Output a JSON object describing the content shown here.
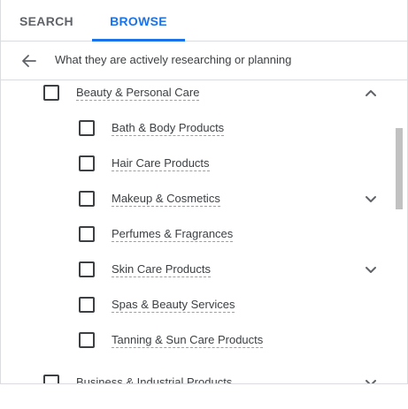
{
  "tabs": [
    {
      "label": "SEARCH",
      "active": false
    },
    {
      "label": "BROWSE",
      "active": true
    }
  ],
  "accent_color": "#1a73e8",
  "back_row": {
    "text": "What they are actively researching or planning",
    "icon": "arrow-left-icon"
  },
  "categories": {
    "parent": {
      "label": "Beauty & Personal Care",
      "checked": false,
      "expanded": true,
      "icon": "chevron-up-icon"
    },
    "children": [
      {
        "label": "Bath & Body Products",
        "checked": false,
        "has_children": false
      },
      {
        "label": "Hair Care Products",
        "checked": false,
        "has_children": false
      },
      {
        "label": "Makeup & Cosmetics",
        "checked": false,
        "has_children": true
      },
      {
        "label": "Perfumes & Fragrances",
        "checked": false,
        "has_children": false
      },
      {
        "label": "Skin Care Products",
        "checked": false,
        "has_children": true
      },
      {
        "label": "Spas & Beauty Services",
        "checked": false,
        "has_children": false
      },
      {
        "label": "Tanning & Sun Care Products",
        "checked": false,
        "has_children": false
      }
    ],
    "next_parent": {
      "label": "Business & Industrial Products",
      "checked": false,
      "expanded": false,
      "icon": "chevron-down-icon"
    }
  }
}
